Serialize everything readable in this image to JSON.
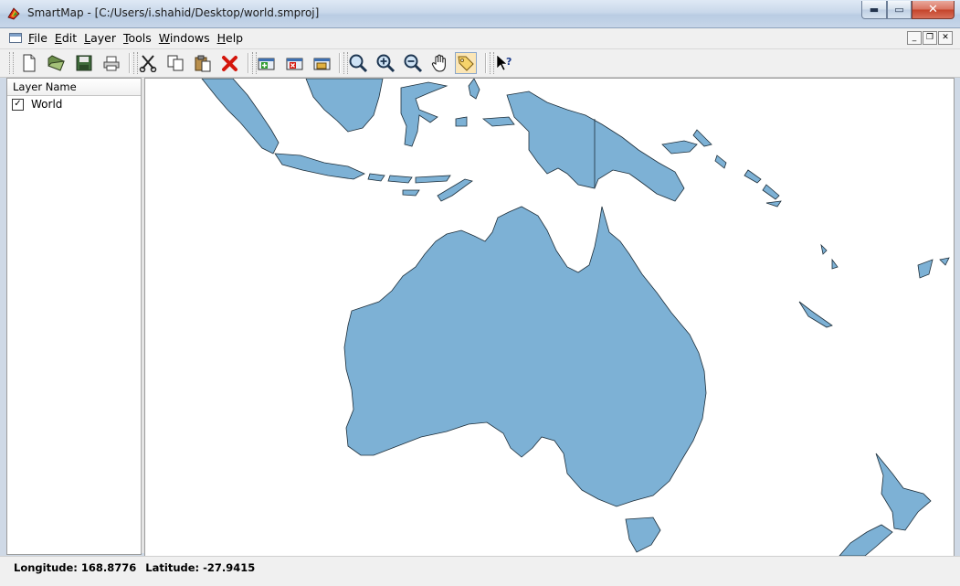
{
  "window": {
    "title": "SmartMap - [C:/Users/i.shahid/Desktop/world.smproj]",
    "min_glyph": "▬",
    "max_glyph": "▭",
    "close_glyph": "✕"
  },
  "menu": {
    "items": [
      "File",
      "Edit",
      "Layer",
      "Tools",
      "Windows",
      "Help"
    ],
    "mdi_min": "_",
    "mdi_restore": "❐",
    "mdi_close": "✕"
  },
  "toolbar": {
    "buttons": [
      {
        "icon": "new-document-icon"
      },
      {
        "icon": "open-folder-icon"
      },
      {
        "icon": "save-icon"
      },
      {
        "icon": "print-icon"
      },
      {
        "icon": "cut-icon"
      },
      {
        "icon": "copy-icon"
      },
      {
        "icon": "paste-icon"
      },
      {
        "icon": "delete-icon"
      },
      {
        "icon": "add-layer-icon"
      },
      {
        "icon": "remove-layer-icon"
      },
      {
        "icon": "layer-properties-icon"
      },
      {
        "icon": "zoom-icon"
      },
      {
        "icon": "zoom-in-icon"
      },
      {
        "icon": "zoom-out-icon"
      },
      {
        "icon": "pan-hand-icon"
      },
      {
        "icon": "label-tag-icon",
        "pressed": true
      },
      {
        "icon": "whats-this-help-icon"
      }
    ]
  },
  "layers": {
    "header": "Layer Name",
    "items": [
      {
        "name": "World",
        "checked": true
      }
    ]
  },
  "map": {
    "land_color": "#7db1d5",
    "border_color": "#1d2e3a",
    "regions": [
      "Australia",
      "New Guinea",
      "Indonesia",
      "New Zealand",
      "Tasmania",
      "Pacific islands"
    ]
  },
  "status": {
    "longitude": "Longitude: 168.8776",
    "latitude": "Latitude: -27.9415"
  }
}
